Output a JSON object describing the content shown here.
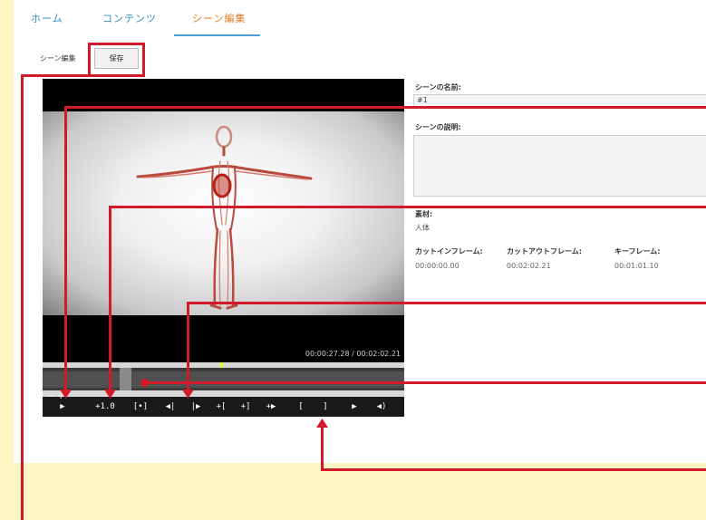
{
  "nav": {
    "items": [
      {
        "label": "ホーム"
      },
      {
        "label": "コンテンツ"
      },
      {
        "label": "シーン編集"
      }
    ],
    "active_index": 2
  },
  "toolbar": {
    "section_label": "シーン編集",
    "save_label": "保存"
  },
  "player": {
    "timecode": "00:00:27.28 / 00:02:02.21",
    "zoom_minus": "−",
    "zoom_plus": "+",
    "controls": [
      {
        "label": "▶",
        "icon": "play-icon"
      },
      {
        "label": "+1.0",
        "icon": "speed-rate"
      },
      {
        "label": "[•]",
        "icon": "jump-to-in-out-icon"
      },
      {
        "label": "◀|",
        "icon": "step-back-icon"
      },
      {
        "label": "|▶",
        "icon": "step-forward-icon"
      },
      {
        "label": "+[",
        "icon": "go-to-in-icon"
      },
      {
        "label": "+]",
        "icon": "go-to-out-icon"
      },
      {
        "label": "+▶",
        "icon": "go-to-keyframe-icon"
      },
      {
        "label": "[",
        "icon": "set-in-icon"
      },
      {
        "label": "]",
        "icon": "set-out-icon"
      },
      {
        "label": "▶",
        "icon": "set-keyframe-icon"
      },
      {
        "label": "◀)",
        "icon": "volume-icon"
      }
    ],
    "position_fraction": 0.222
  },
  "form": {
    "name_label": "シーンの名前:",
    "name_value": "#1",
    "description_label": "シーンの説明:",
    "description_value": "",
    "material_label": "素材:",
    "material_value": "人体",
    "cut_in_label": "カットインフレーム:",
    "cut_in_value": "00:00:00.00",
    "cut_out_label": "カットアウトフレーム:",
    "cut_out_value": "00:02:02.21",
    "keyframe_label": "キーフレーム:",
    "keyframe_value": "00:01:01.10"
  },
  "colors": {
    "background": "#fff6c4",
    "nav_link": "#2e8bc0",
    "nav_active": "#e07a1f",
    "annotation": "#d11a2a",
    "timeline_marker": "#e6ff1b"
  }
}
